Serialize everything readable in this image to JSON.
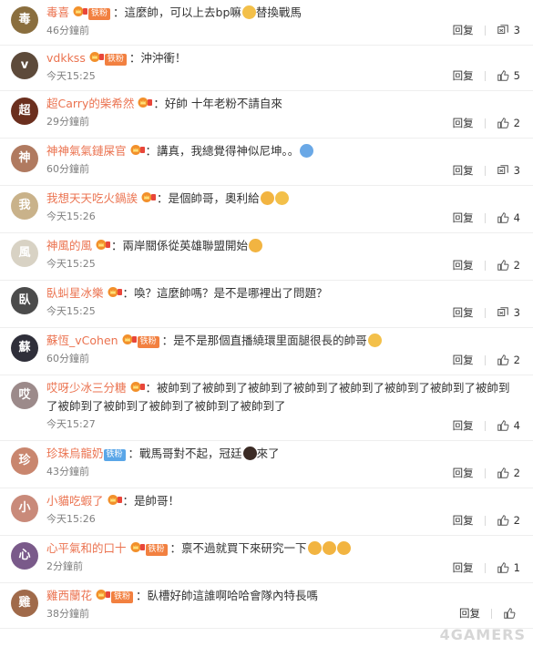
{
  "reply_label": "回复",
  "comments": [
    {
      "user": "毒喜",
      "badge": "铁粉",
      "badge_style": "orange",
      "text": "這麼帥，可以上去bp嘛",
      "emojis": [
        "#f3c04a"
      ],
      "text_after": "替換戰馬",
      "time": "46分鐘前",
      "likes": "3",
      "avatar_color": "#8a6e3e",
      "avatar_letter": "毒",
      "h": 50
    },
    {
      "user": "vdkkss",
      "badge": "铁粉",
      "badge_style": "orange",
      "text": "沖沖衝！",
      "emojis": [],
      "text_after": "",
      "time": "今天15:25",
      "likes": "5",
      "avatar_color": "#5d4a3a",
      "avatar_letter": "v",
      "h": 50
    },
    {
      "user": "超Carry的柴希然",
      "badge": "",
      "badge_style": "",
      "text": "好帥 十年老粉不請自來",
      "emojis": [],
      "text_after": "",
      "time": "29分鐘前",
      "likes": "2",
      "avatar_color": "#6b2f1e",
      "avatar_letter": "超",
      "h": 52
    },
    {
      "user": "神神氣氣鏈屎官",
      "badge": "",
      "badge_style": "",
      "text": "講真，我總覺得神似尼坤。。",
      "emojis": [
        "#6aa8e6"
      ],
      "text_after": "",
      "time": "60分鐘前",
      "likes": "3",
      "avatar_color": "#b07a60",
      "avatar_letter": "神",
      "h": 52
    },
    {
      "user": "我想天天吃火鍋誒",
      "badge": "",
      "badge_style": "",
      "text": "是個帥哥，奧利給",
      "emojis": [
        "#f2b441",
        "#f3c04a"
      ],
      "text_after": "",
      "time": "今天15:26",
      "likes": "4",
      "avatar_color": "#c9b28a",
      "avatar_letter": "我",
      "h": 52
    },
    {
      "user": "神風的風",
      "badge": "",
      "badge_style": "",
      "text": "兩岸關係從英雄聯盟開始",
      "emojis": [
        "#f2b441"
      ],
      "text_after": "",
      "time": "今天15:25",
      "likes": "2",
      "avatar_color": "#d8d2c4",
      "avatar_letter": "風",
      "h": 52
    },
    {
      "user": "臥虯星冰樂",
      "badge": "",
      "badge_style": "",
      "text": "喚？這麼帥嗎？是不是哪裡出了問題？",
      "emojis": [],
      "text_after": "",
      "time": "今天15:25",
      "likes": "3",
      "avatar_color": "#4b4b4b",
      "avatar_letter": "臥",
      "h": 52
    },
    {
      "user": "蘇恆_vCohen",
      "badge": "铁粉",
      "badge_style": "orange",
      "text": "是不是那個直播繞環里面腿很長的帥哥",
      "emojis": [
        "#f3c04a"
      ],
      "text_after": "",
      "time": "60分鐘前",
      "likes": "2",
      "avatar_color": "#2f2f3a",
      "avatar_letter": "蘇",
      "h": 52
    },
    {
      "user": "哎呀少冰三分糖",
      "badge": "",
      "badge_style": "",
      "text": "被帥到了被帥到了被帥到了被帥到了被帥到了被帥到了被帥到了被帥到了被帥到了被帥到了被帥到了被帥到了被帥到了",
      "emojis": [],
      "text_after": "",
      "time": "今天15:27",
      "likes": "4",
      "avatar_color": "#9c8a8a",
      "avatar_letter": "哎",
      "h": 72
    },
    {
      "user": "珍珠烏龍奶",
      "badge": "铁粉",
      "badge_style": "blue",
      "text": "戰馬哥對不起，冠廷",
      "emojis": [
        "#3b2b25"
      ],
      "text_after": "來了",
      "time": "43分鐘前",
      "likes": "2",
      "avatar_color": "#c9866e",
      "avatar_letter": "珍",
      "h": 52
    },
    {
      "user": "小貓吃蝦了",
      "badge": "",
      "badge_style": "",
      "text": "是帥哥！",
      "emojis": [],
      "text_after": "",
      "time": "今天15:26",
      "likes": "2",
      "avatar_color": "#c98a7a",
      "avatar_letter": "小",
      "h": 52
    },
    {
      "user": "心平氣和的口十",
      "badge": "铁粉",
      "badge_style": "orange",
      "text": "禀不過就買下來研究一下",
      "emojis": [
        "#f2b441",
        "#f2b441",
        "#f2b441"
      ],
      "text_after": "",
      "time": "2分鐘前",
      "likes": "1",
      "avatar_color": "#7a5a8a",
      "avatar_letter": "心",
      "h": 52
    },
    {
      "user": "雞西蘭花",
      "badge": "铁粉",
      "badge_style": "orange",
      "text": "臥槽好帥這誰啊哈哈會隊內特長嗎",
      "emojis": [],
      "text_after": "",
      "time": "38分鐘前",
      "likes": "",
      "avatar_color": "#a06a4a",
      "avatar_letter": "雞",
      "h": 50
    }
  ],
  "watermark": "4GAMERS"
}
